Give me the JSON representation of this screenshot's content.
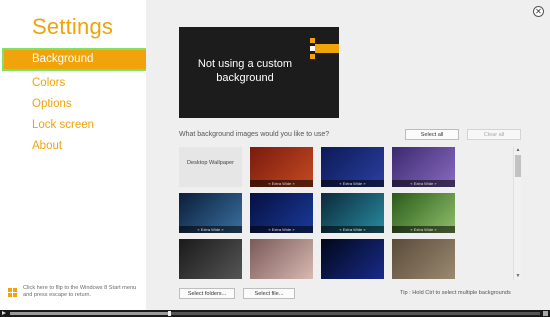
{
  "settings": {
    "title": "Settings",
    "nav": [
      "Background",
      "Colors",
      "Options",
      "Lock screen",
      "About"
    ],
    "active_index": 0,
    "flip_hint": "Click here to flip to the Windows 8 Start menu and press escape to return.",
    "flip_icon": "windows-logo-icon"
  },
  "main": {
    "close_icon": "close-icon",
    "preview_text": "Not using a custom background",
    "question": "What background images would you like to use?",
    "select_all": "Select all",
    "clear_all": "Clear all",
    "desktop_wallpaper_label": "Desktop Wallpaper",
    "thumb_label": "« Extra Wide »",
    "select_folders": "Select folders...",
    "select_file": "Select file...",
    "tip": "Tip : Hold Ctrl to select multiple backgrounds"
  },
  "thumbnails": [
    {
      "name": "desktop-wallpaper-thumb",
      "kind": "desktop",
      "colors": [
        "#e6e6e6",
        "#e6e6e6"
      ],
      "extra_wide": false
    },
    {
      "name": "red-bokeh-thumb",
      "kind": "image",
      "colors": [
        "#7a1a0e",
        "#c44a22"
      ],
      "extra_wide": true
    },
    {
      "name": "blue-nebula-thumb",
      "kind": "image",
      "colors": [
        "#0b1a55",
        "#2b3fa0"
      ],
      "extra_wide": true
    },
    {
      "name": "purple-dusk-thumb",
      "kind": "image",
      "colors": [
        "#3a2a6e",
        "#8a6ac0"
      ],
      "extra_wide": true
    },
    {
      "name": "night-blue-thumb",
      "kind": "image",
      "colors": [
        "#0a1e3a",
        "#3a6fa0"
      ],
      "extra_wide": true
    },
    {
      "name": "starry-blue-thumb",
      "kind": "image",
      "colors": [
        "#061040",
        "#1a3a9a"
      ],
      "extra_wide": true
    },
    {
      "name": "tree-teal-thumb",
      "kind": "image",
      "colors": [
        "#0a2a3a",
        "#2a8aa0"
      ],
      "extra_wide": true
    },
    {
      "name": "golf-green-thumb",
      "kind": "image",
      "colors": [
        "#2a5a1a",
        "#8fc06a"
      ],
      "extra_wide": true
    },
    {
      "name": "dark-stone-thumb",
      "kind": "image",
      "colors": [
        "#1a1a1a",
        "#555555"
      ],
      "extra_wide": false
    },
    {
      "name": "rose-cup-thumb",
      "kind": "image",
      "colors": [
        "#7a5a5a",
        "#d8b8b0"
      ],
      "extra_wide": false
    },
    {
      "name": "blue-wave-thumb",
      "kind": "image",
      "colors": [
        "#000818",
        "#1a2a8a"
      ],
      "extra_wide": false
    },
    {
      "name": "cracked-earth-thumb",
      "kind": "image",
      "colors": [
        "#5a4a3a",
        "#9a8a70"
      ],
      "extra_wide": false
    }
  ],
  "player": {
    "progress": 0.3
  }
}
